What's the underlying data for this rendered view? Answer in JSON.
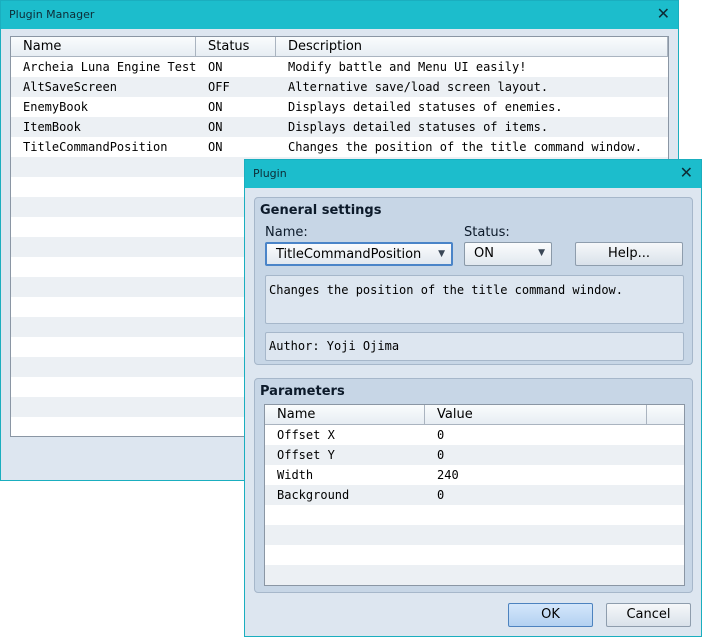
{
  "plugin_manager": {
    "title": "Plugin Manager",
    "close_glyph": "✕",
    "columns": [
      "Name",
      "Status",
      "Description"
    ],
    "rows": [
      {
        "name": "Archeia Luna Engine Test",
        "status": "ON",
        "description": "Modify battle and Menu UI easily!"
      },
      {
        "name": "AltSaveScreen",
        "status": "OFF",
        "description": "Alternative save/load screen layout."
      },
      {
        "name": "EnemyBook",
        "status": "ON",
        "description": "Displays detailed statuses of enemies."
      },
      {
        "name": "ItemBook",
        "status": "ON",
        "description": "Displays detailed statuses of items."
      },
      {
        "name": "TitleCommandPosition",
        "status": "ON",
        "description": "Changes the position of the title command window."
      }
    ]
  },
  "plugin_dialog": {
    "title": "Plugin",
    "close_glyph": "✕",
    "general": {
      "heading": "General settings",
      "name_label": "Name:",
      "name_value": "TitleCommandPosition",
      "status_label": "Status:",
      "status_value": "ON",
      "help_label": "Help...",
      "description": "Changes the position of the title command window.",
      "author": "Author: Yoji Ojima"
    },
    "parameters": {
      "heading": "Parameters",
      "columns": [
        "Name",
        "Value"
      ],
      "rows": [
        {
          "name": "Offset X",
          "value": "0"
        },
        {
          "name": "Offset Y",
          "value": "0"
        },
        {
          "name": "Width",
          "value": "240"
        },
        {
          "name": "Background",
          "value": "0"
        }
      ]
    },
    "ok_label": "OK",
    "cancel_label": "Cancel"
  }
}
